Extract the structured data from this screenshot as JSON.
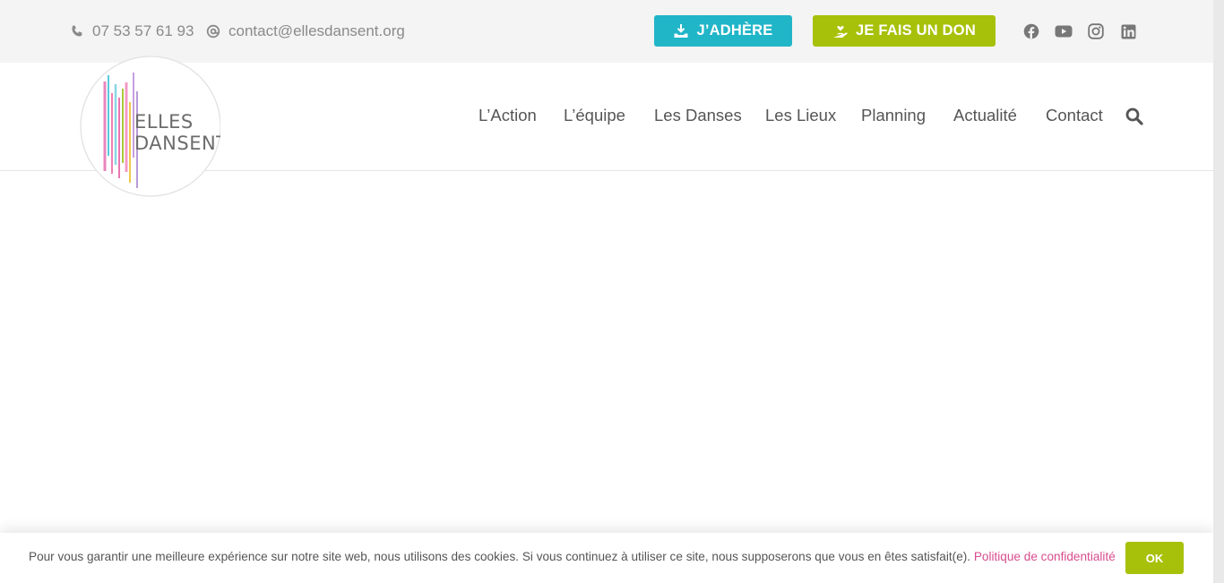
{
  "topbar": {
    "phone": "07 53 57 61 93",
    "email": "contact@ellesdansent.org",
    "adhere_label": "J’ADHÈRE",
    "don_label": "JE FAIS UN DON",
    "socials": [
      "facebook-icon",
      "youtube-icon",
      "instagram-icon",
      "linkedin-icon"
    ]
  },
  "logo": {
    "line1": "ELLES",
    "line2": "DANSENT"
  },
  "nav": {
    "items": [
      "L’Action",
      "L’équipe",
      "Les Danses",
      "Les Lieux",
      "Planning",
      "Actualité",
      "Contact"
    ]
  },
  "cookie": {
    "text": "Pour vous garantir une meilleure expérience sur notre site web, nous utilisons des cookies. Si vous continuez à utiliser ce site, nous supposerons que vous en êtes satisfait(e).",
    "policy_link": "Politique de confidentialité",
    "ok_label": "OK"
  },
  "colors": {
    "adhere": "#21b5c8",
    "don": "#a7c10a",
    "link_pink": "#d84c8e",
    "topbar_bg": "#f4f4f4"
  }
}
